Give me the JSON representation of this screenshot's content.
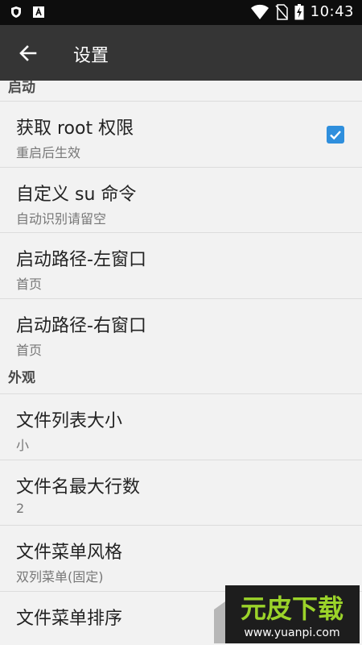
{
  "status_bar": {
    "time": "10:43",
    "left_icons": [
      "shield-icon",
      "a-box-icon"
    ],
    "right_icons": [
      "wifi-icon",
      "no-sim-icon",
      "battery-charging-icon"
    ]
  },
  "app_bar": {
    "title": "设置",
    "back_icon": "arrow-left-icon",
    "color": "#353535"
  },
  "sections": [
    {
      "header": "启动",
      "items": [
        {
          "title": "获取 root 权限",
          "summary": "重启后生效",
          "checked": true
        },
        {
          "title": "自定义 su 命令",
          "summary": "自动识别请留空"
        },
        {
          "title": "启动路径-左窗口",
          "summary": "首页"
        },
        {
          "title": "启动路径-右窗口",
          "summary": "首页"
        }
      ]
    },
    {
      "header": "外观",
      "items": [
        {
          "title": "文件列表大小",
          "summary": "小"
        },
        {
          "title": "文件名最大行数",
          "summary": "2"
        },
        {
          "title": "文件菜单风格",
          "summary": "双列菜单(固定)"
        },
        {
          "title": "文件菜单排序",
          "summary": ""
        }
      ]
    }
  ],
  "watermark": {
    "text": "元皮下载",
    "url": "www.yuanpi.com"
  },
  "colors": {
    "accent": "#2f8fdd",
    "background": "#f2f2f2",
    "status_bar": "#0d0d0d"
  }
}
